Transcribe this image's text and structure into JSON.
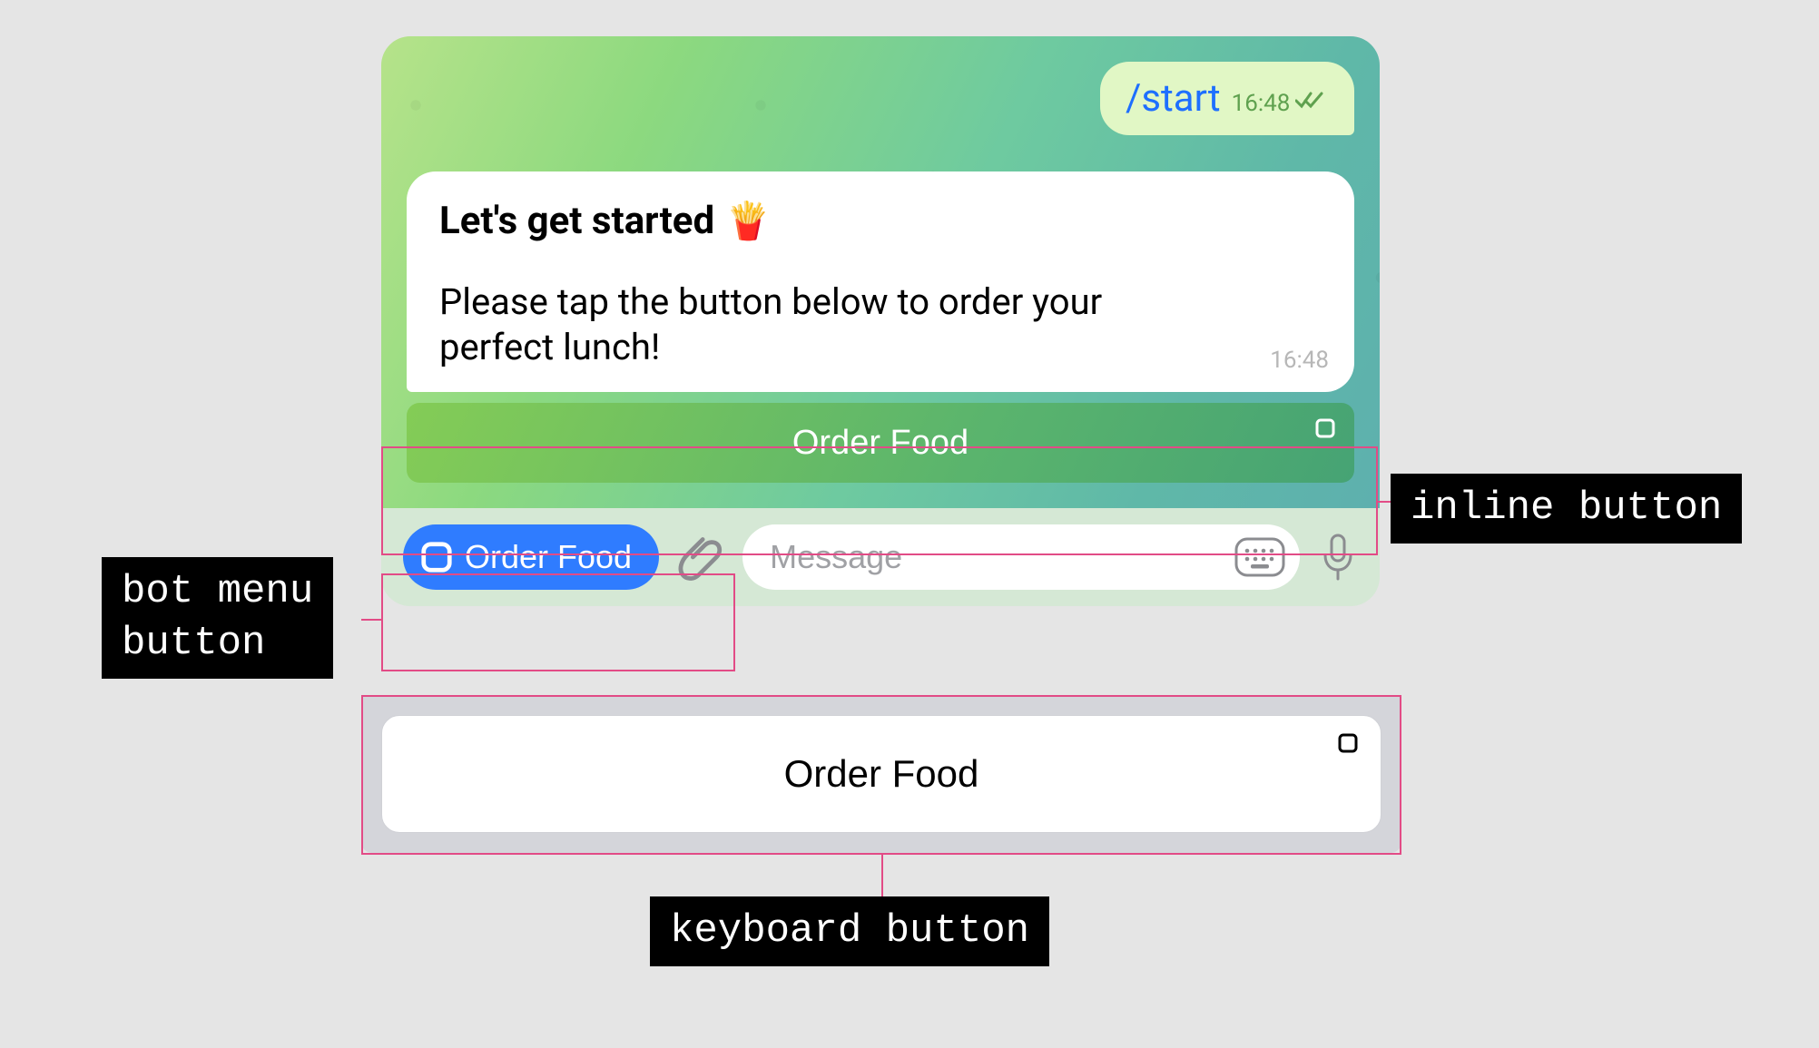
{
  "outgoing": {
    "command": "/start",
    "time": "16:48"
  },
  "incoming": {
    "title": "Let's get started",
    "emoji": "🍟",
    "body": "Please tap the button below to order your perfect lunch!",
    "time": "16:48"
  },
  "inline_button": {
    "label": "Order Food"
  },
  "menu_button": {
    "label": "Order Food"
  },
  "input": {
    "placeholder": "Message"
  },
  "keyboard_button": {
    "label": "Order Food"
  },
  "annotations": {
    "inline": "inline button",
    "menu": "bot menu\nbutton",
    "keyboard": "keyboard button"
  }
}
